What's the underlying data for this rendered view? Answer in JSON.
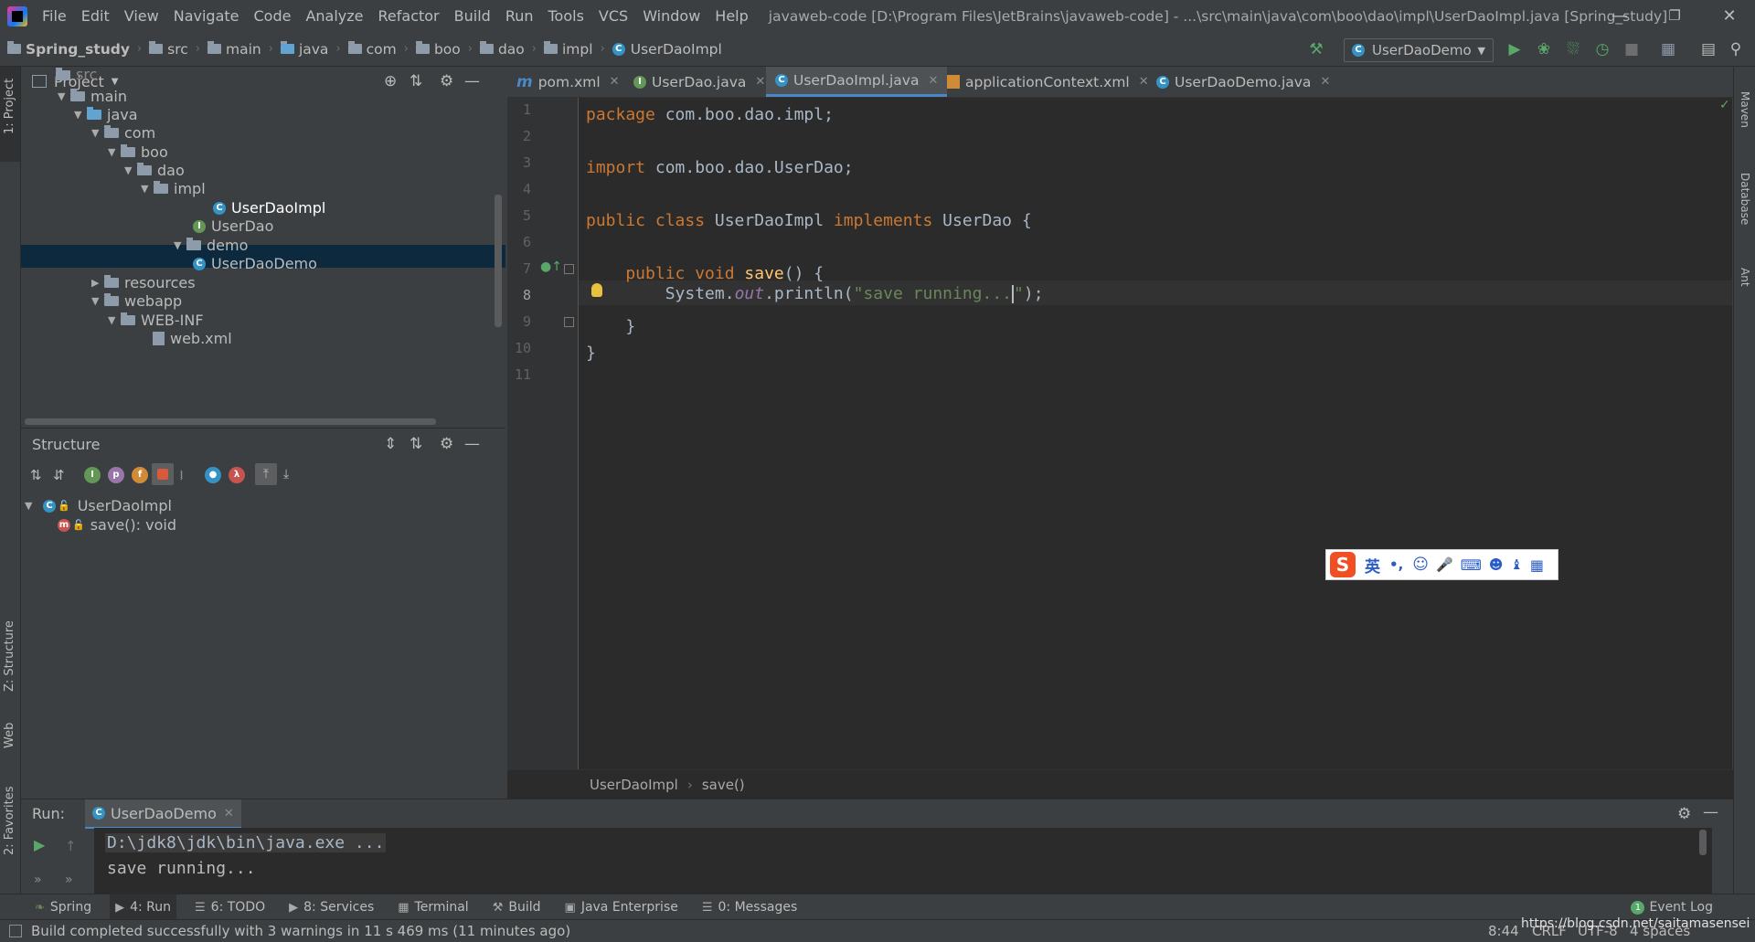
{
  "menu": {
    "items": [
      "File",
      "Edit",
      "View",
      "Navigate",
      "Code",
      "Analyze",
      "Refactor",
      "Build",
      "Run",
      "Tools",
      "VCS",
      "Window",
      "Help"
    ],
    "window_title": "javaweb-code [D:\\Program Files\\JetBrains\\javaweb-code] - ...\\src\\main\\java\\com\\boo\\dao\\impl\\UserDaoImpl.java [Spring_study]"
  },
  "navbar": {
    "crumbs": [
      "Spring_study",
      "src",
      "main",
      "java",
      "com",
      "boo",
      "dao",
      "impl",
      "UserDaoImpl"
    ],
    "run_config": "UserDaoDemo"
  },
  "left_strip": {
    "project": "1: Project",
    "structure": "Z: Structure",
    "web": "Web",
    "favorites": "2: Favorites"
  },
  "right_strip": {
    "maven": "Maven",
    "database": "Database",
    "ant": "Ant"
  },
  "project_panel": {
    "title": "Project",
    "tree": [
      {
        "label": "src"
      },
      {
        "label": "main"
      },
      {
        "label": "java"
      },
      {
        "label": "com"
      },
      {
        "label": "boo"
      },
      {
        "label": "dao"
      },
      {
        "label": "impl"
      },
      {
        "label": "UserDaoImpl"
      },
      {
        "label": "UserDao"
      },
      {
        "label": "demo"
      },
      {
        "label": "UserDaoDemo"
      },
      {
        "label": "resources"
      },
      {
        "label": "webapp"
      },
      {
        "label": "WEB-INF"
      },
      {
        "label": "web.xml"
      }
    ]
  },
  "structure_panel": {
    "title": "Structure",
    "class_name": "UserDaoImpl",
    "method": "save(): void"
  },
  "editor": {
    "tabs": [
      {
        "label": "pom.xml",
        "icon": "m"
      },
      {
        "label": "UserDao.java",
        "icon": "I"
      },
      {
        "label": "UserDaoImpl.java",
        "icon": "C"
      },
      {
        "label": "applicationContext.xml",
        "icon": "xml"
      },
      {
        "label": "UserDaoDemo.java",
        "icon": "C"
      }
    ],
    "line_numbers": [
      "1",
      "2",
      "3",
      "4",
      "5",
      "6",
      "7",
      "8",
      "9",
      "10",
      "11"
    ],
    "code": {
      "l1_kw": "package",
      "l1_rest": " com.boo.dao.impl;",
      "l3_kw": "import",
      "l3_rest": " com.boo.dao.UserDao;",
      "l5_kw1": "public class",
      "l5_cls": " UserDaoImpl ",
      "l5_kw2": "implements",
      "l5_rest": " UserDao {",
      "l7_kw": "    public void ",
      "l7_fn": "save",
      "l7_rest": "() {",
      "l8_a": "        System.",
      "l8_fld": "out",
      "l8_b": ".println(",
      "l8_str": "\"save running...",
      "l8_str2": "\"",
      "l8_c": ");",
      "l9": "    }",
      "l10": "}"
    },
    "breadcrumb_class": "UserDaoImpl",
    "breadcrumb_method": "save()"
  },
  "ime": {
    "lang": "英",
    "punct": "•,"
  },
  "run_panel": {
    "label": "Run:",
    "tab": "UserDaoDemo",
    "cmd": "D:\\jdk8\\jdk\\bin\\java.exe ...",
    "output": "save running..."
  },
  "tool_tabs": [
    {
      "label": "Spring"
    },
    {
      "label": "4: Run"
    },
    {
      "label": "6: TODO"
    },
    {
      "label": "8: Services"
    },
    {
      "label": "Terminal"
    },
    {
      "label": "Build"
    },
    {
      "label": "Java Enterprise"
    },
    {
      "label": "0: Messages"
    }
  ],
  "event_log": {
    "count": "1",
    "label": "Event Log"
  },
  "status": {
    "message": "Build completed successfully with 3 warnings in 11 s 469 ms (11 minutes ago)",
    "position": "8:44",
    "line_sep": "CRLF",
    "encoding": "UTF-8",
    "indent": "4 spaces",
    "watermark": "https://blog.csdn.net/saitamasensei"
  },
  "colors": {
    "accent": "#4a88c7",
    "keyword": "#cc7832",
    "string": "#6a8759",
    "selection": "#0d293e"
  }
}
